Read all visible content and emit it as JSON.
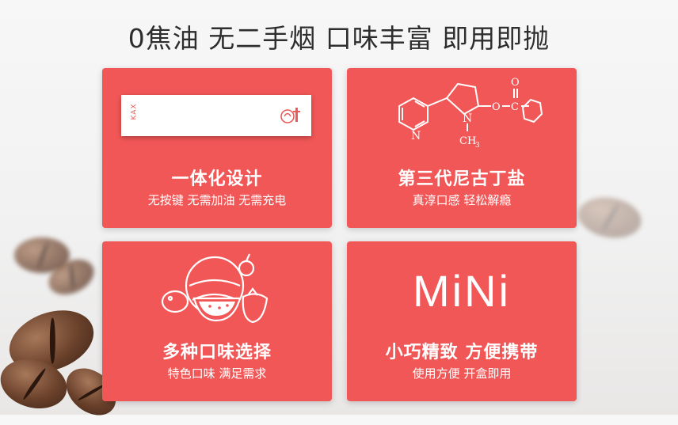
{
  "headline": "0焦油 无二手烟 口味丰富 即用即抛",
  "cards": [
    {
      "title": "一体化设计",
      "subtitle": "无按键 无需加油 无需充电",
      "image": {
        "brand": "KAX",
        "icon": "product-stick"
      }
    },
    {
      "title": "第三代尼古丁盐",
      "subtitle": "真淳口感 轻松解瘾",
      "image": {
        "icon": "molecule-structure",
        "labels": [
          "N",
          "N",
          "O",
          "O",
          "C",
          "CH",
          "3"
        ]
      }
    },
    {
      "title": "多种口味选择",
      "subtitle": "特色口味 满足需求",
      "image": {
        "icon": "fruits-icon"
      }
    },
    {
      "title": "小巧精致 方便携带",
      "subtitle": "使用方便 开盒即用",
      "image": {
        "text": "MiNi"
      }
    }
  ],
  "colors": {
    "card_bg": "#f25757",
    "card_text": "#ffffff",
    "headline": "#2e2e2e"
  }
}
